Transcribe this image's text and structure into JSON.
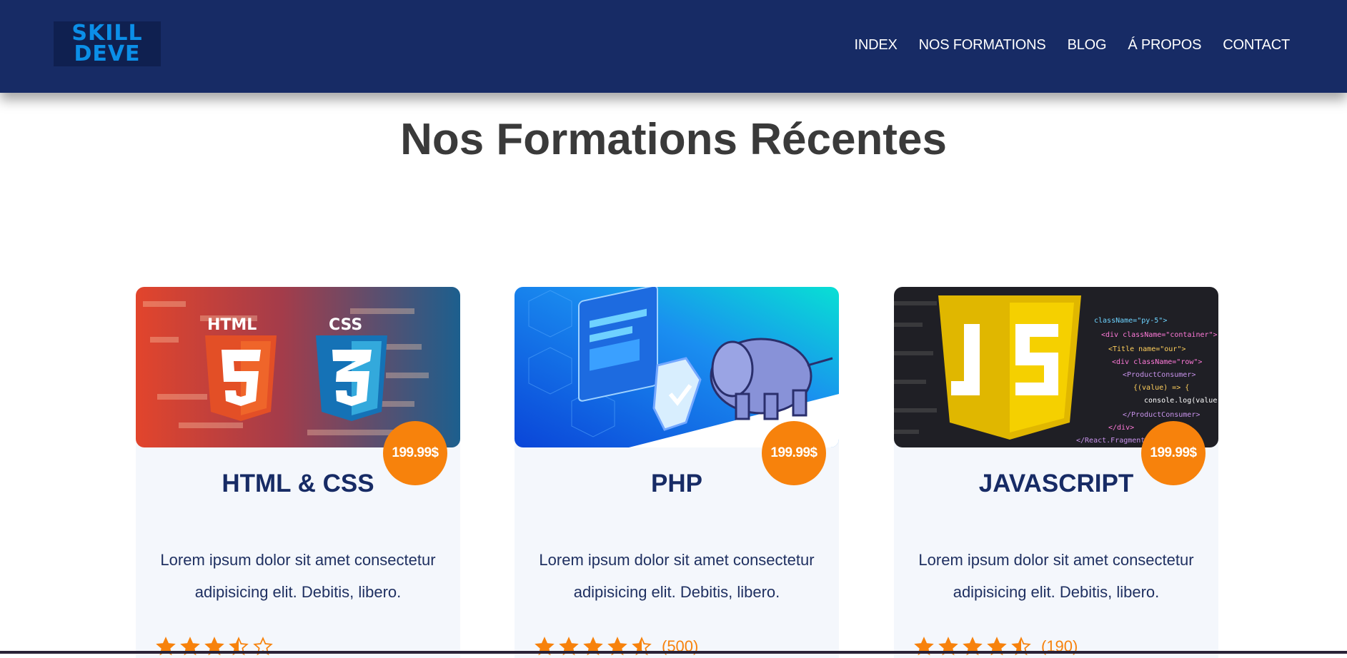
{
  "header": {
    "logo": {
      "line1": "SKILL",
      "line2": "DEVE"
    },
    "nav": [
      {
        "label": "INDEX"
      },
      {
        "label": "NOS FORMATIONS"
      },
      {
        "label": "BLOG"
      },
      {
        "label": "Á PROPOS"
      },
      {
        "label": "CONTACT"
      }
    ]
  },
  "main": {
    "title": "Nos Formations Récentes",
    "cards": [
      {
        "title": "HTML & CSS",
        "price": "199.99$",
        "description": "Lorem ipsum dolor sit amet consectetur adipisicing elit. Debitis, libero.",
        "rating": 3.5,
        "count": "",
        "image_labels": [
          "HTML",
          "CSS"
        ]
      },
      {
        "title": "PHP",
        "price": "199.99$",
        "description": "Lorem ipsum dolor sit amet consectetur adipisicing elit. Debitis, libero.",
        "rating": 4.5,
        "count": "(500)"
      },
      {
        "title": "JAVASCRIPT",
        "price": "199.99$",
        "description": "Lorem ipsum dolor sit amet consectetur adipisicing elit. Debitis, libero.",
        "rating": 4.5,
        "count": "(190)"
      }
    ]
  },
  "colors": {
    "header": "#172b65",
    "accent": "#f7820c",
    "card_bg": "#f4f7fc",
    "title_text": "#3a3a3a"
  }
}
